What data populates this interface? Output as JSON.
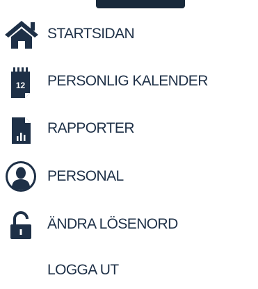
{
  "nav": {
    "items": [
      {
        "label": "STARTSIDAN",
        "icon": "home-icon"
      },
      {
        "label": "PERSONLIG KALENDER",
        "icon": "calendar-icon",
        "calendar_day": "12"
      },
      {
        "label": "RAPPORTER",
        "icon": "report-icon"
      },
      {
        "label": "PERSONAL",
        "icon": "person-icon"
      },
      {
        "label": "ÄNDRA LÖSENORD",
        "icon": "lock-icon"
      },
      {
        "label": "LOGGA UT"
      }
    ]
  },
  "colors": {
    "icon": "#1e3047",
    "text": "#1e3047",
    "background": "#ffffff"
  }
}
